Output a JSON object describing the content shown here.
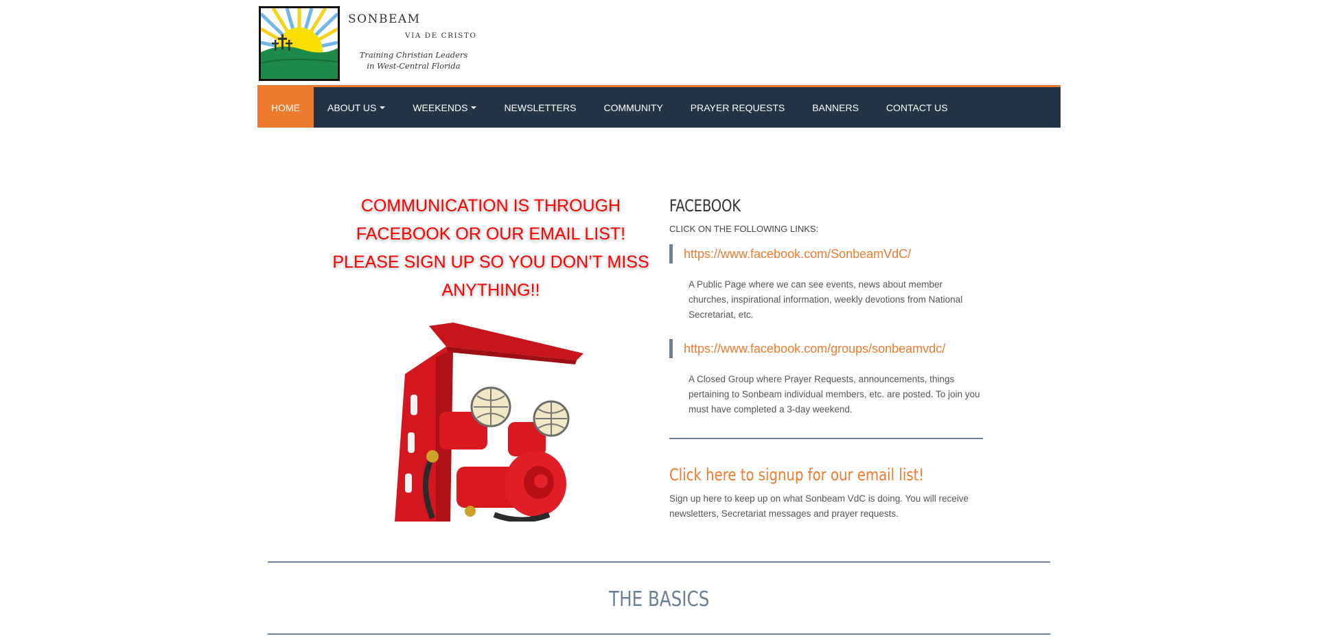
{
  "header": {
    "brand_name": "SONBEAM",
    "brand_sub": "VIA DE CRISTO",
    "tagline_line1": "Training Christian Leaders",
    "tagline_line2": "in West-Central Florida"
  },
  "nav": {
    "items": [
      {
        "label": "HOME",
        "active": true,
        "dropdown": false
      },
      {
        "label": "ABOUT US",
        "active": false,
        "dropdown": true
      },
      {
        "label": "WEEKENDS",
        "active": false,
        "dropdown": true
      },
      {
        "label": "NEWSLETTERS",
        "active": false,
        "dropdown": false
      },
      {
        "label": "COMMUNITY",
        "active": false,
        "dropdown": false
      },
      {
        "label": "PRAYER REQUESTS",
        "active": false,
        "dropdown": false
      },
      {
        "label": "BANNERS",
        "active": false,
        "dropdown": false
      },
      {
        "label": "CONTACT US",
        "active": false,
        "dropdown": false
      }
    ]
  },
  "promo": {
    "line1": "COMMUNICATION IS THROUGH",
    "line2": "FACEBOOK OR OUR EMAIL LIST!",
    "line3": "PLEASE SIGN UP SO YOU DON’T MISS",
    "line4": "ANYTHING!!"
  },
  "facebook": {
    "heading": "FACEBOOK",
    "subheading": "CLICK ON THE FOLLOWING LINKS:",
    "links": [
      {
        "url": "https://www.facebook.com/SonbeamVdC/",
        "description": "A Public Page where we can see events, news about member churches, inspirational information, weekly devotions from National Secretariat, etc."
      },
      {
        "url": "https://www.facebook.com/groups/sonbeamvdc/",
        "description": "A Closed Group where Prayer Requests, announcements, things pertaining to Sonbeam individual members, etc. are posted. To join you must have completed a 3-day weekend."
      }
    ]
  },
  "signup": {
    "link_text": "Click here to signup for our email list!",
    "description": "Sign up here to keep up on what Sonbeam VdC is doing. You will receive newsletters, Secretariat messages and prayer requests."
  },
  "basics": {
    "heading": "THE BASICS"
  },
  "colors": {
    "accent": "#ee7a2e",
    "nav_bg": "#233447",
    "promo_red": "#ff0000",
    "rule": "#6b7f96"
  }
}
